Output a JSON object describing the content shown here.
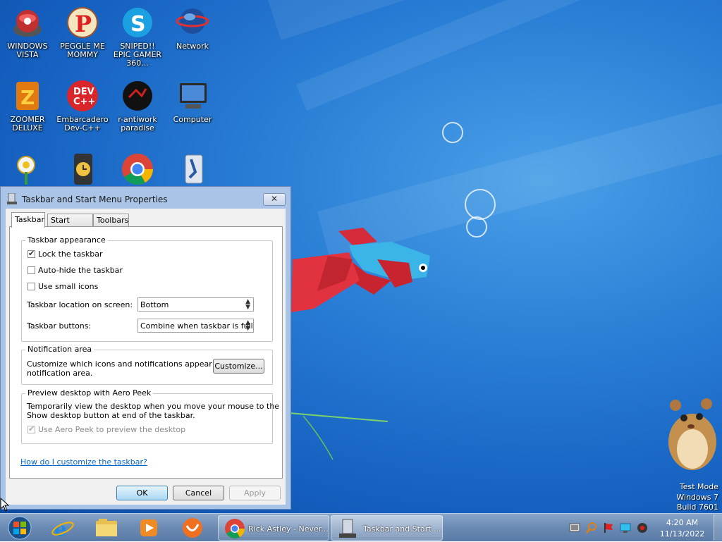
{
  "desktop": {
    "icons": [
      {
        "label": "WINDOWS VISTA",
        "icon": "vista-ball-icon"
      },
      {
        "label": "PEGGLE ME MOMMY",
        "icon": "peggle-icon"
      },
      {
        "label": "SNIPED!! EPIC GAMER 360...",
        "icon": "skype-icon"
      },
      {
        "label": "Network",
        "icon": "network-globe-icon"
      },
      {
        "label": "ZOOMER DELUXE",
        "icon": "zoomer-icon"
      },
      {
        "label": "Embarcadero Dev-C++",
        "icon": "devcpp-icon"
      },
      {
        "label": "r-antiwork paradise",
        "icon": "antiwork-icon"
      },
      {
        "label": "Computer",
        "icon": "computer-icon"
      },
      {
        "label": "",
        "icon": "plants-zombies-icon"
      },
      {
        "label": "",
        "icon": "clock-app-icon"
      },
      {
        "label": "",
        "icon": "chrome-icon"
      },
      {
        "label": "",
        "icon": "installer-icon"
      }
    ],
    "dev_badge": "DEV\nC++",
    "watermark": [
      "Test Mode",
      "Windows 7",
      "Build 7601"
    ]
  },
  "dialog": {
    "title": "Taskbar and Start Menu Properties",
    "close_label": "✕",
    "tabs": [
      "Taskbar",
      "Start Menu",
      "Toolbars"
    ],
    "appearance": {
      "group_title": "Taskbar appearance",
      "lock_label": "Lock the taskbar",
      "autohide_label": "Auto-hide the taskbar",
      "small_icons_label": "Use small icons",
      "location_label": "Taskbar location on screen:",
      "location_value": "Bottom",
      "buttons_label": "Taskbar buttons:",
      "buttons_value": "Combine when taskbar is full"
    },
    "notification": {
      "group_title": "Notification area",
      "text1": "Customize which icons and notifications appear in the",
      "text2": "notification area.",
      "customize_label": "Customize..."
    },
    "peek": {
      "group_title": "Preview desktop with Aero Peek",
      "text1": "Temporarily view the desktop when you move your mouse to the",
      "text2": "Show desktop button at end of the taskbar.",
      "use_label": "Use Aero Peek to preview the desktop"
    },
    "help_link": "How do I customize the taskbar?",
    "ok_label": "OK",
    "cancel_label": "Cancel",
    "apply_label": "Apply"
  },
  "taskbar": {
    "pinned": [
      "start-orb-icon",
      "internet-explorer-icon",
      "file-explorer-icon",
      "media-player-icon",
      "uc-browser-icon"
    ],
    "tasks": [
      {
        "label": "Rick Astley - Never...",
        "icon": "chrome-icon"
      },
      {
        "label": "Taskbar and Start ...",
        "icon": "taskbar-properties-icon"
      }
    ],
    "time": "4:20 AM",
    "date": "11/13/2022"
  }
}
